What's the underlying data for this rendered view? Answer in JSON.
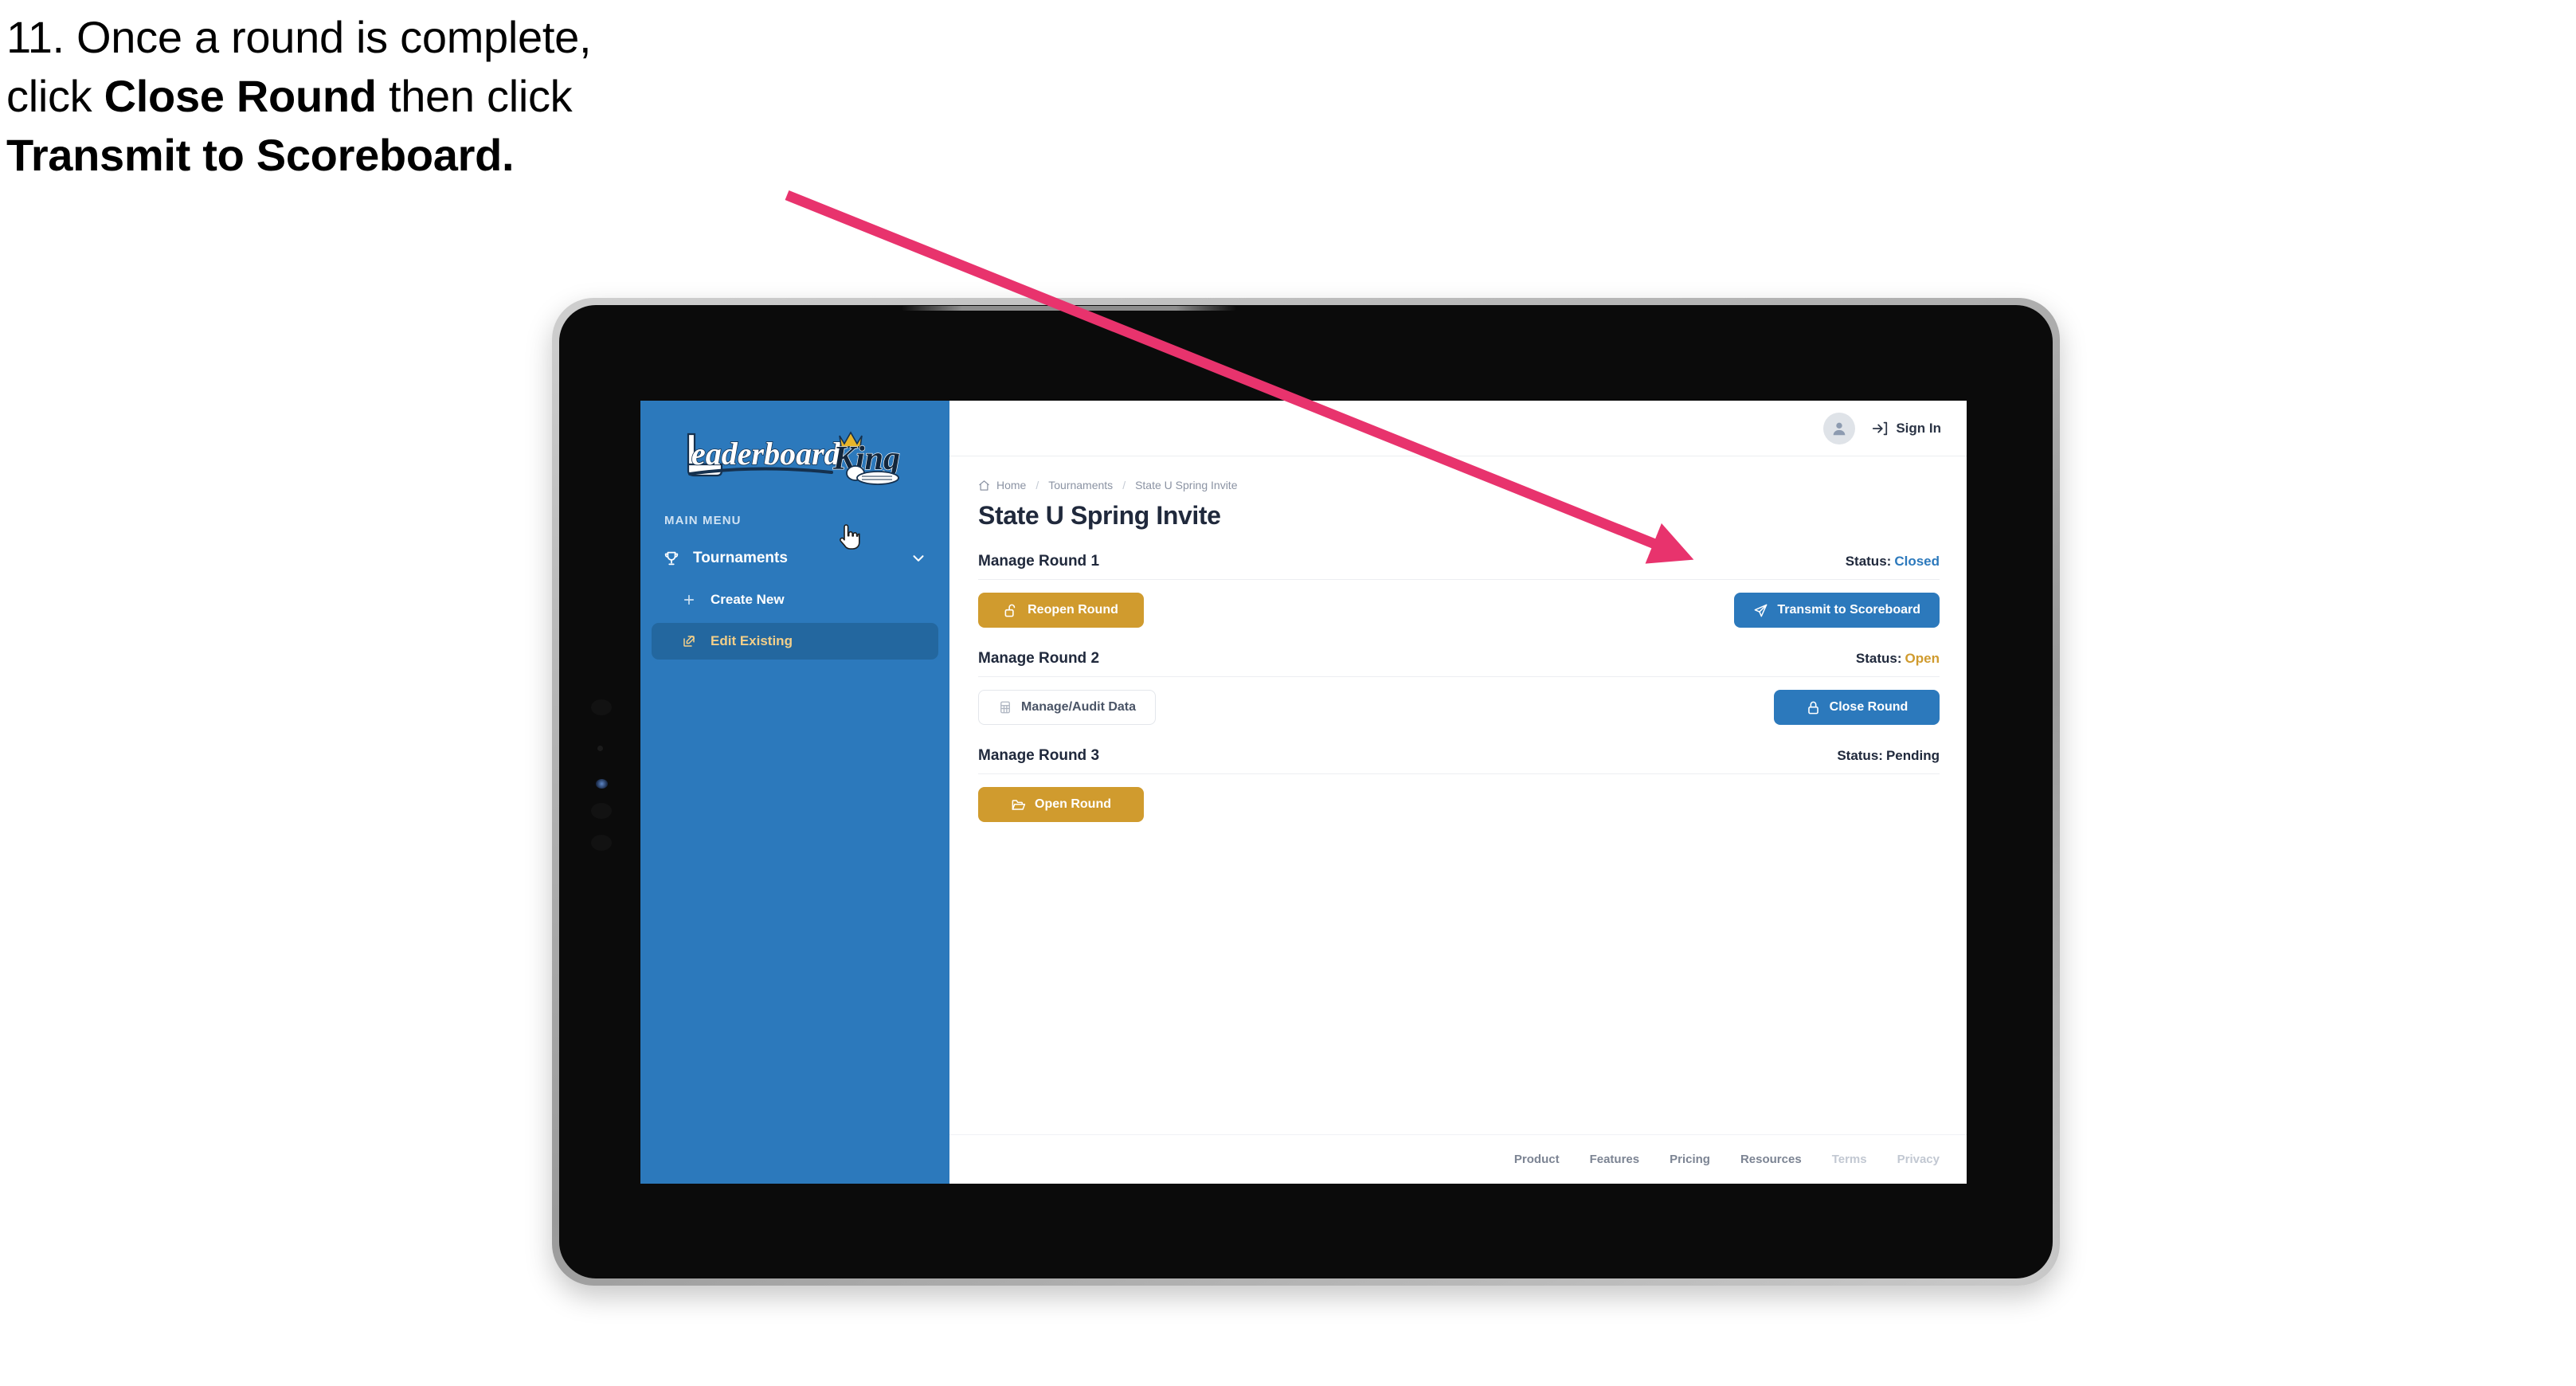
{
  "annotation": {
    "step_number": "11.",
    "line1_prefix": "11. Once a round is complete,",
    "line2_a": "click ",
    "line2_bold": "Close Round",
    "line2_b": " then click",
    "line3_bold": "Transmit to Scoreboard.",
    "arrow_color": "#E8336D"
  },
  "device": {
    "type": "tablet",
    "frame_color": "#0b0b0b",
    "bezel_color": "#b6b6b6"
  },
  "colors": {
    "brand_blue": "#2C79BC",
    "brand_gold": "#D09B2E",
    "sidebar_active": "#23679f",
    "text_dark": "#20293c",
    "accent_gold_text": "#f2cf8a"
  },
  "sidebar": {
    "logo_text_primary": "Leaderboard",
    "logo_text_secondary": "King",
    "section_label": "MAIN MENU",
    "items": [
      {
        "label": "Tournaments",
        "icon": "trophy-icon",
        "expanded": true,
        "chevron": "chevron-down-icon"
      },
      {
        "label": "Create New",
        "icon": "plus-icon",
        "active": false
      },
      {
        "label": "Edit Existing",
        "icon": "edit-square-icon",
        "active": true
      }
    ]
  },
  "topbar": {
    "avatar_icon": "user-avatar-icon",
    "signin_icon": "sign-in-arrow-icon",
    "signin_label": "Sign In"
  },
  "breadcrumb": {
    "home_icon": "home-icon",
    "items": [
      "Home",
      "Tournaments",
      "State U Spring Invite"
    ],
    "separator": "/"
  },
  "page": {
    "title": "State U Spring Invite"
  },
  "rounds": [
    {
      "title": "Manage Round 1",
      "status_label": "Status:",
      "status_value": "Closed",
      "status_class": "status-closed",
      "left_button": {
        "label": "Reopen Round",
        "icon": "unlock-icon",
        "style": "gold"
      },
      "right_button": {
        "label": "Transmit to Scoreboard",
        "icon": "send-plane-icon",
        "style": "blue"
      }
    },
    {
      "title": "Manage Round 2",
      "status_label": "Status:",
      "status_value": "Open",
      "status_class": "status-open",
      "left_button": {
        "label": "Manage/Audit Data",
        "icon": "grid-table-icon",
        "style": "ghost"
      },
      "right_button": {
        "label": "Close Round",
        "icon": "lock-icon",
        "style": "blue"
      }
    },
    {
      "title": "Manage Round 3",
      "status_label": "Status:",
      "status_value": "Pending",
      "status_class": "status-pending",
      "left_button": {
        "label": "Open Round",
        "icon": "open-folder-icon",
        "style": "gold"
      },
      "right_button": null
    }
  ],
  "footer": {
    "links": [
      {
        "label": "Product",
        "dim": false
      },
      {
        "label": "Features",
        "dim": false
      },
      {
        "label": "Pricing",
        "dim": false
      },
      {
        "label": "Resources",
        "dim": false
      },
      {
        "label": "Terms",
        "dim": true
      },
      {
        "label": "Privacy",
        "dim": true
      }
    ]
  },
  "cursor": {
    "type": "pointing-hand-cursor"
  }
}
